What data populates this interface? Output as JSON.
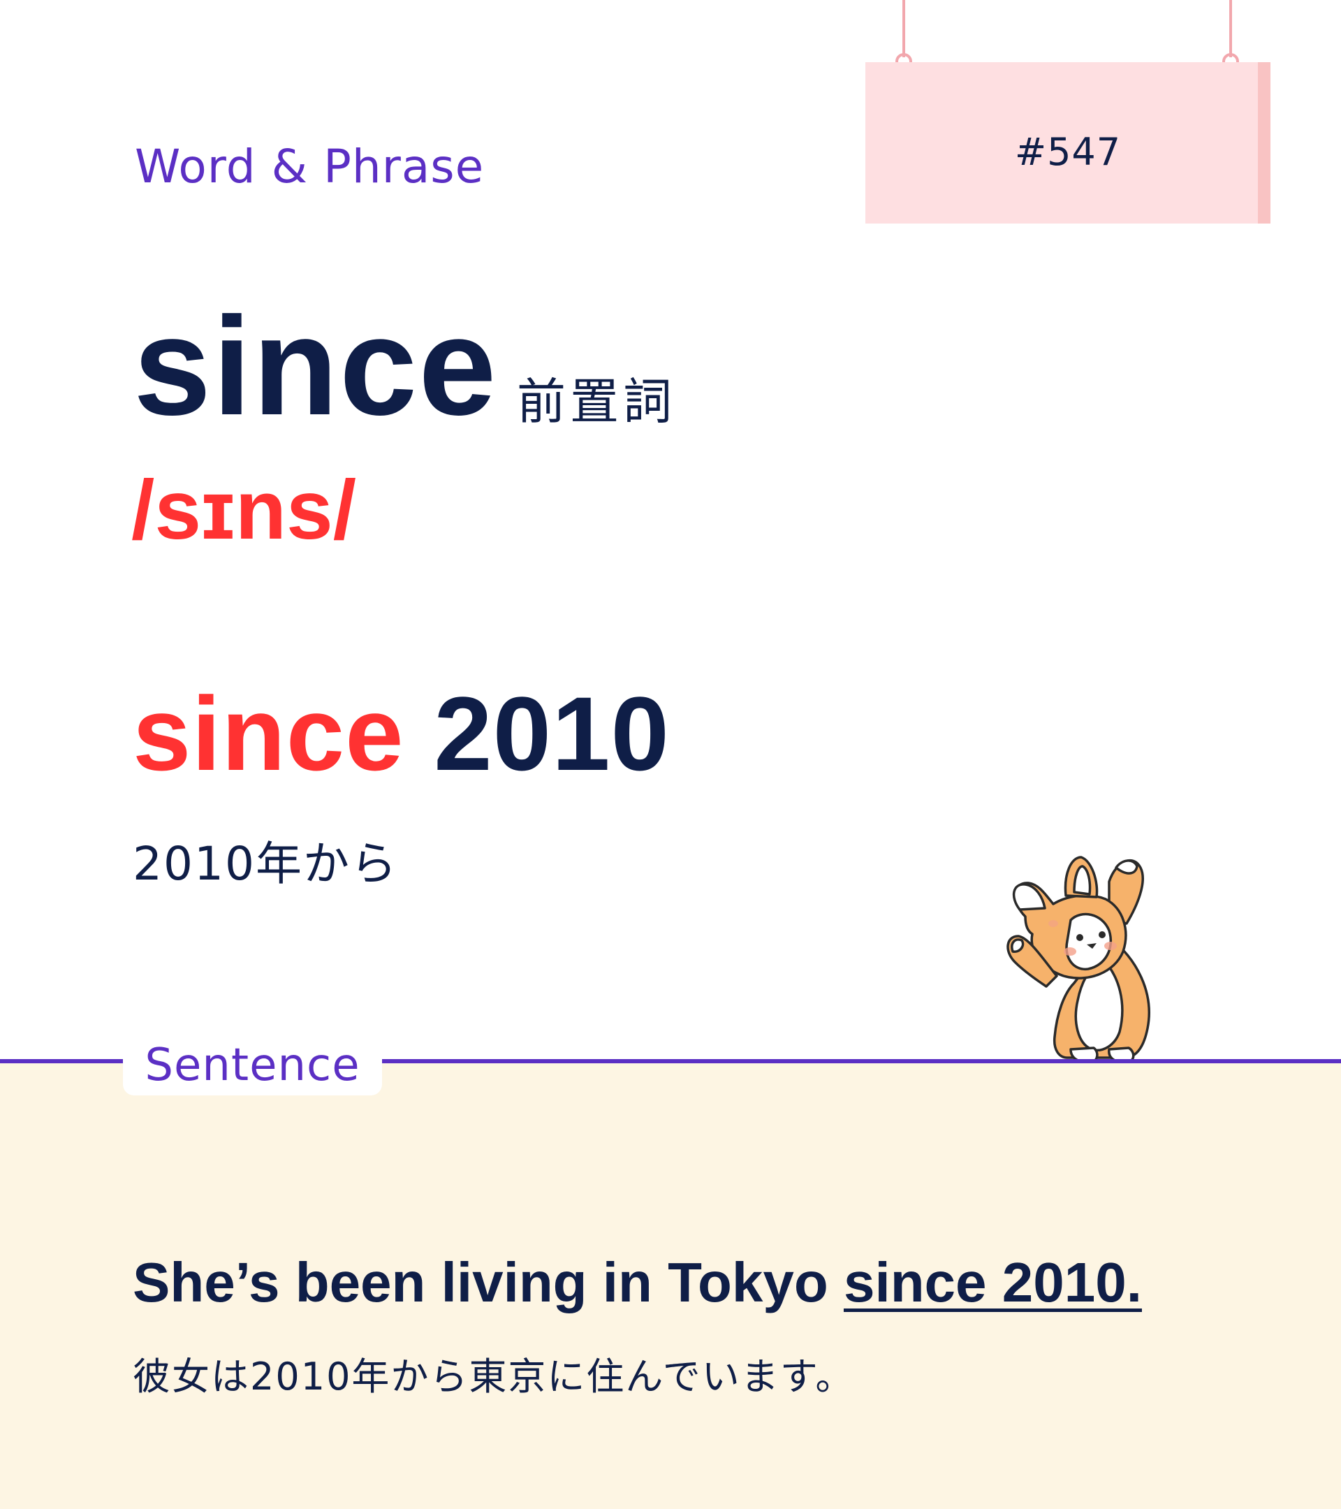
{
  "header": {
    "section_label": "Word & Phrase",
    "card_number": "#547"
  },
  "word": {
    "headword": "since",
    "part_of_speech": "前置詞",
    "pronunciation": "/sɪns/"
  },
  "phrase": {
    "highlight": "since",
    "rest": " 2010",
    "translation": "2010年から"
  },
  "sentence": {
    "label": "Sentence",
    "text_before": "She’s been living in Tokyo ",
    "text_underlined": "since 2010.",
    "translation": "彼女は2010年から東京に住んでいます。"
  },
  "illustration": {
    "icon": "corgi-stretching-icon"
  },
  "colors": {
    "accent_purple": "#5b2fc4",
    "highlight_red": "#ff3232",
    "text_navy": "#0f1e47",
    "sign_pink": "#fedfe1",
    "sentence_bg": "#fdf5e3"
  }
}
